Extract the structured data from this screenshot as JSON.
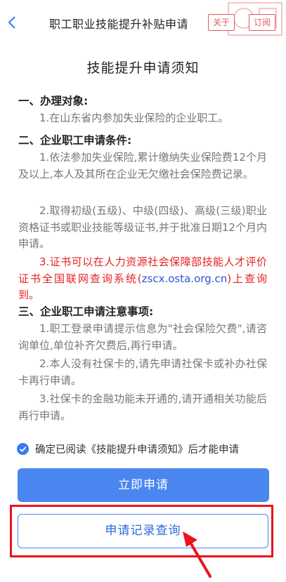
{
  "header": {
    "title": "职工职业技能提升补贴申请",
    "about_label": "关于",
    "subscribe_label": "订阅"
  },
  "notice": {
    "title": "技能提升申请须知",
    "section1": {
      "heading": "一、办理对象:",
      "p1": "1.在山东省内参加失业保险的企业职工。"
    },
    "section2": {
      "heading": "二、企业职工申请条件:",
      "p1": "1.依法参加失业保险,累计缴纳失业保险费12个月及以上,本人及其所在企业无欠缴社会保险费记录。",
      "p2": "2.取得初级(五级)、中级(四级)、高级(三级)职业资格证书或职业技能等级证书,并于批准日期12个月内申请。",
      "p3_before": "3.证书可以在人力资源社会保障部技能人才评价证书全国联网查询系统(",
      "p3_link": "zscx.osta.org.cn",
      "p3_after": ")上查询到。"
    },
    "section3": {
      "heading": "三、企业职工申请注意事项:",
      "p1": "1.职工登录申请提示信息为\"社会保险欠费\",请咨询单位,单位补齐欠费后,再行申请。",
      "p2": "2.本人没有社保卡的,请先申请社保卡或补办社保卡再行申请。",
      "p3": "3.社保卡的金融功能未开通的,请开通相关功能后再行申请。"
    }
  },
  "agreement": {
    "checked": true,
    "text": "确定已阅读《技能提升申请须知》后才能申请"
  },
  "actions": {
    "apply_label": "立即申请",
    "record_label": "申请记录查询"
  },
  "colors": {
    "primary": "#4a86f0",
    "warning_red": "#e52222",
    "annotation_red": "#e8141b",
    "link_blue": "#2557d6"
  }
}
